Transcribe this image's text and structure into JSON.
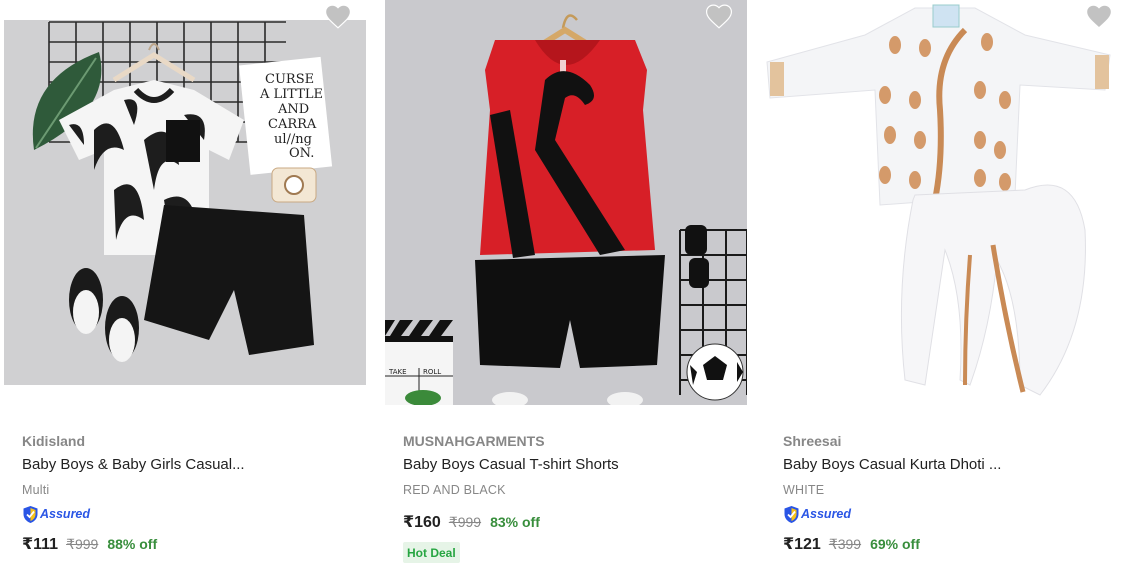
{
  "products": [
    {
      "brand": "Kidisland",
      "title": "Baby Boys & Baby Girls Casual...",
      "color": "Multi",
      "assured_label": "Assured",
      "price": "₹111",
      "mrp": "₹999",
      "discount": "88% off",
      "image_text": [
        "CURSE",
        "A LITTLE",
        "AND",
        "CARRA",
        "ul//ng",
        "ON."
      ]
    },
    {
      "brand": "MUSNAHGARMENTS",
      "title": "Baby Boys Casual T-shirt Shorts",
      "color": "RED AND BLACK",
      "price": "₹160",
      "mrp": "₹999",
      "discount": "83% off",
      "badge": "Hot Deal",
      "image_text": [
        "TAKE",
        "ROLL"
      ]
    },
    {
      "brand": "Shreesai",
      "title": "Baby Boys Casual Kurta Dhoti ...",
      "color": "WHITE",
      "assured_label": "Assured",
      "price": "₹121",
      "mrp": "₹399",
      "discount": "69% off"
    }
  ],
  "colors": {
    "accent_blue": "#2a55e5",
    "discount_green": "#388e3c",
    "badge_bg": "#e6f4e7",
    "heart_gray": "#c2c2c2"
  },
  "icons": [
    "heart-icon",
    "assured-shield-icon"
  ]
}
